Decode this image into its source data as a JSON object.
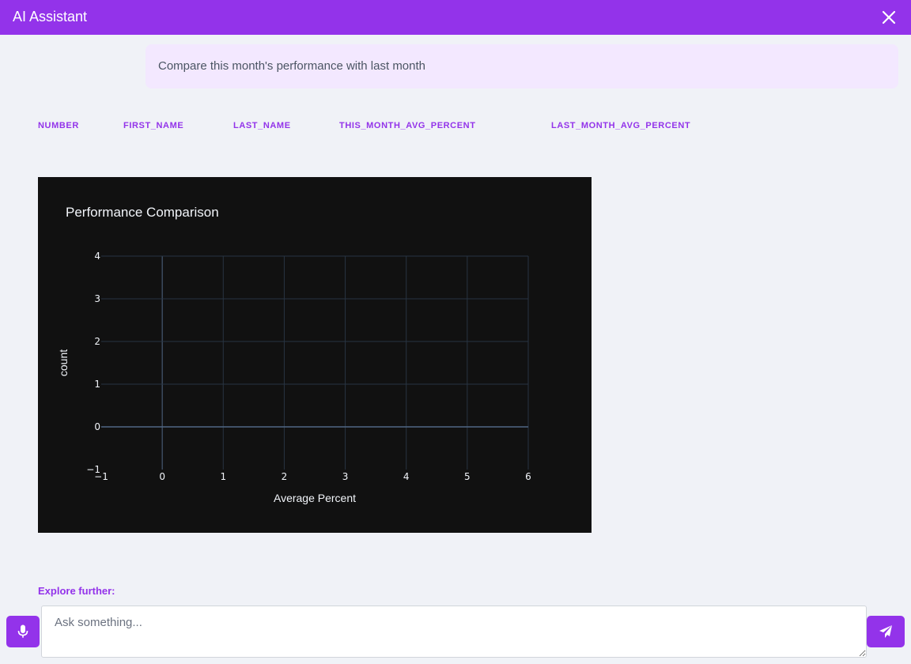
{
  "header": {
    "title": "AI Assistant",
    "close_icon": "close-icon"
  },
  "user_message": {
    "text": "Compare this month's performance with last month"
  },
  "table": {
    "columns": [
      "NUMBER",
      "FIRST_NAME",
      "LAST_NAME",
      "THIS_MONTH_AVG_PERCENT",
      "LAST_MONTH_AVG_PERCENT"
    ],
    "rows": []
  },
  "chart_data": {
    "type": "bar",
    "title": "Performance Comparison",
    "xlabel": "Average Percent",
    "ylabel": "count",
    "xlim": [
      -1,
      6
    ],
    "ylim": [
      -1,
      4
    ],
    "x_ticks": [
      "−1",
      "0",
      "1",
      "2",
      "3",
      "4",
      "5",
      "6"
    ],
    "y_ticks": [
      "−1",
      "0",
      "1",
      "2",
      "3",
      "4"
    ],
    "series": [],
    "grid": true,
    "colors": {
      "background": "#111111",
      "grid": "#283442",
      "zero_line": "#506784",
      "text": "#f2f5fa"
    }
  },
  "explore": {
    "label": "Explore further:"
  },
  "input": {
    "placeholder": "Ask something...",
    "value": ""
  },
  "icons": {
    "mic": "microphone-icon",
    "send": "paper-plane-icon"
  },
  "colors": {
    "accent": "#9333ea",
    "bubble": "#f3e8ff",
    "page": "#f0f2f7"
  }
}
